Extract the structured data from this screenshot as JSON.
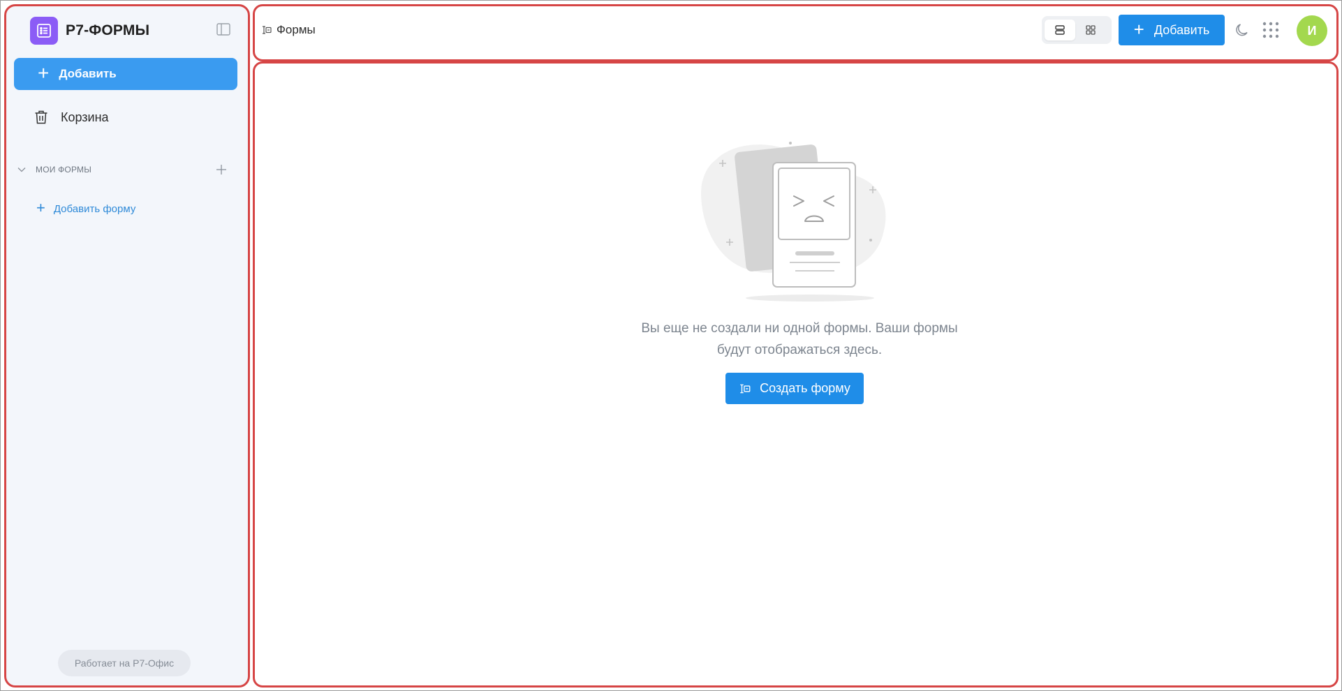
{
  "app": {
    "name": "Р7-ФОРМЫ",
    "colors": {
      "brand": "#8b5cf6",
      "primary": "#1f8de8",
      "sidebar_add": "#3a9bf0",
      "link": "#2f8ad8",
      "avatar_bg": "#a3d84e",
      "highlight_border": "#d64545"
    }
  },
  "sidebar": {
    "add_label": "Добавить",
    "trash_label": "Корзина",
    "section_title": "МОИ ФОРМЫ",
    "add_form_label": "Добавить форму",
    "powered_by": "Работает на Р7-Офис"
  },
  "header": {
    "breadcrumb": "Формы",
    "view_modes": [
      "list-view-icon",
      "grid-view-icon"
    ],
    "active_view": "list",
    "add_label": "Добавить",
    "avatar_letter": "И"
  },
  "main": {
    "empty_line1": "Вы еще не создали ни одной формы. Ваши формы",
    "empty_line2": "будут отображаться здесь.",
    "create_label": "Создать форму"
  }
}
